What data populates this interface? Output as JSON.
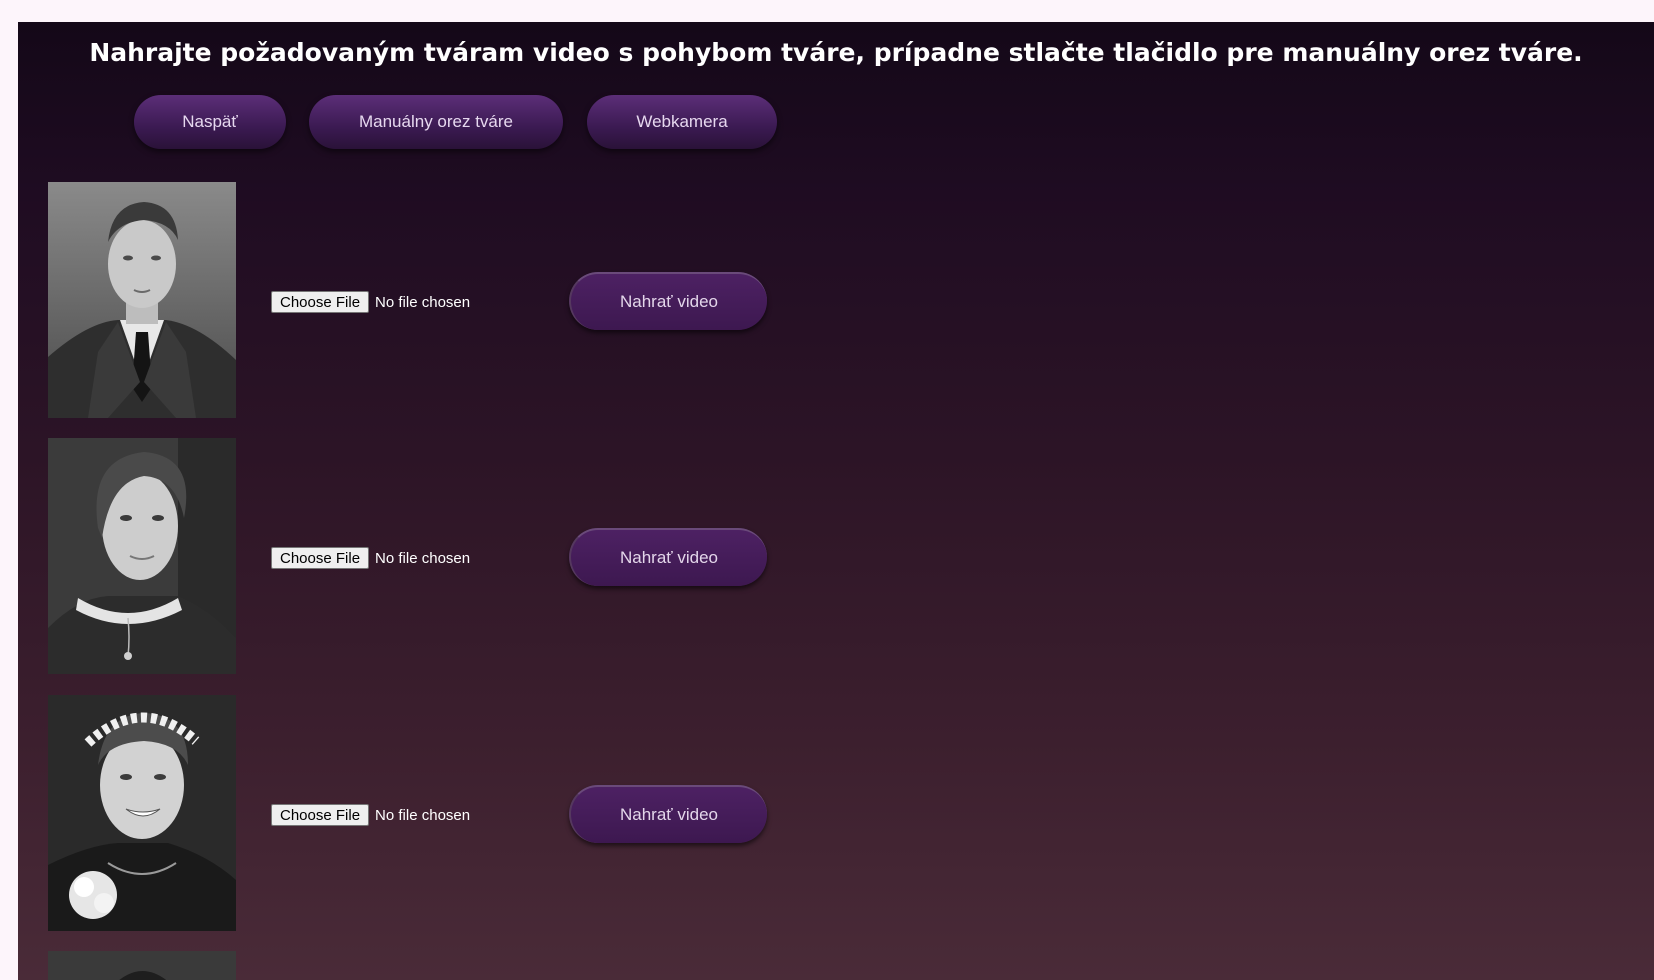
{
  "header": {
    "title": "Nahrajte požadovaným tváram video s pohybom tváre, prípadne stlačte tlačidlo pre manuálny orez tváre."
  },
  "nav": {
    "back_label": "Naspäť",
    "manual_crop_label": "Manuálny orez tváre",
    "webcam_label": "Webkamera"
  },
  "faces": [
    {
      "choose_label": "Choose File",
      "file_status": "No file chosen",
      "upload_label": "Nahrať video"
    },
    {
      "choose_label": "Choose File",
      "file_status": "No file chosen",
      "upload_label": "Nahrať video"
    },
    {
      "choose_label": "Choose File",
      "file_status": "No file chosen",
      "upload_label": "Nahrať video"
    }
  ],
  "colors": {
    "page_background": "#fdf5fb",
    "panel_top": "#140818",
    "panel_bottom": "#4a2b38",
    "button": "#4d2163",
    "button_text": "#e3d6ea"
  }
}
